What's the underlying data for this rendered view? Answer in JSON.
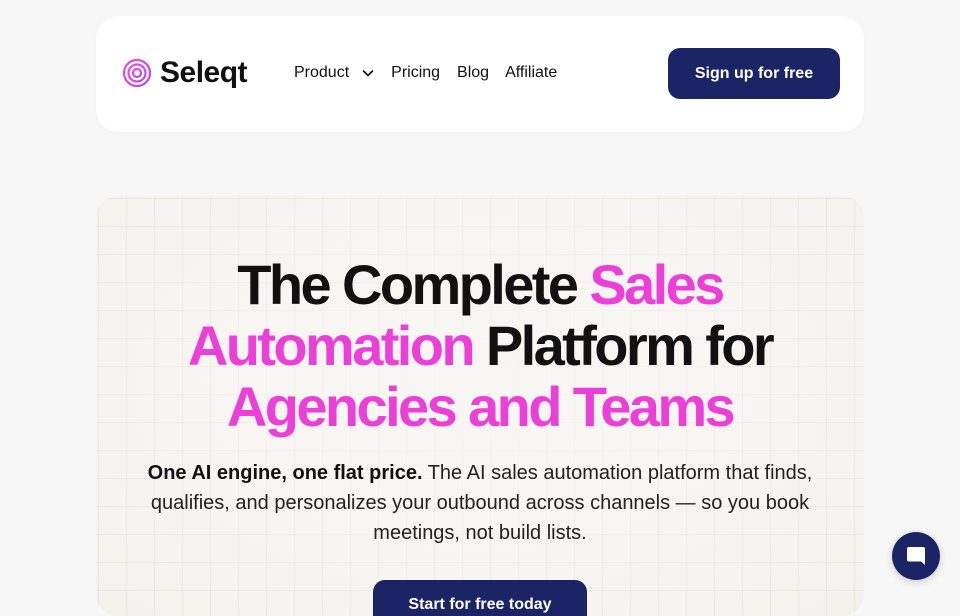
{
  "brand": {
    "name": "Seleqt",
    "logo_icon": "concentric-circles-logo",
    "accent_color": "#ec3fd8",
    "primary_color": "#1b2566"
  },
  "nav": {
    "items": [
      {
        "label": "Product",
        "has_dropdown": true
      },
      {
        "label": "Pricing"
      },
      {
        "label": "Blog"
      },
      {
        "label": "Affiliate"
      }
    ],
    "signup_label": "Sign up for free"
  },
  "hero": {
    "headline": {
      "part1": "The Complete ",
      "part2": "Sales Automation",
      "part3": " Platform for ",
      "part4": "Agencies and Teams"
    },
    "subtext": {
      "lead": "One AI engine, one flat price.",
      "body": " The AI sales automation platform that finds, qualifies, and personalizes your outbound across channels — so you book meetings, not build lists."
    },
    "cta_label": "Start for free today"
  },
  "chat": {
    "icon": "chat-bubble-icon"
  }
}
